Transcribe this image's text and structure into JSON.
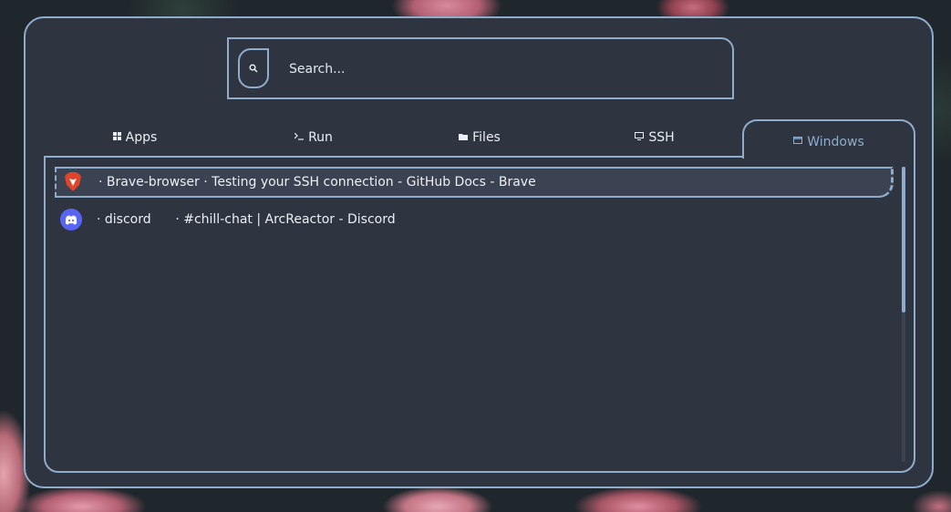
{
  "search": {
    "placeholder": "Search...",
    "value": ""
  },
  "tabs": [
    {
      "label": "Apps",
      "icon": "grid-icon"
    },
    {
      "label": "Run",
      "icon": "terminal-icon"
    },
    {
      "label": "Files",
      "icon": "folder-icon"
    },
    {
      "label": "SSH",
      "icon": "monitor-icon"
    },
    {
      "label": "Windows",
      "icon": "window-icon",
      "active": true
    }
  ],
  "windows": [
    {
      "app": "Brave-browser",
      "text": "· Brave-browser · Testing your SSH connection - GitHub Docs - Brave",
      "icon": "brave-icon",
      "selected": true
    },
    {
      "app": "discord",
      "text": "· discord      · #chill-chat | ArcReactor - Discord",
      "icon": "discord-icon",
      "selected": false
    }
  ],
  "colors": {
    "accent": "#8faccc",
    "background": "#2e3440",
    "text": "#eceff4",
    "brave": "#e0452b",
    "discord": "#5865f2"
  }
}
